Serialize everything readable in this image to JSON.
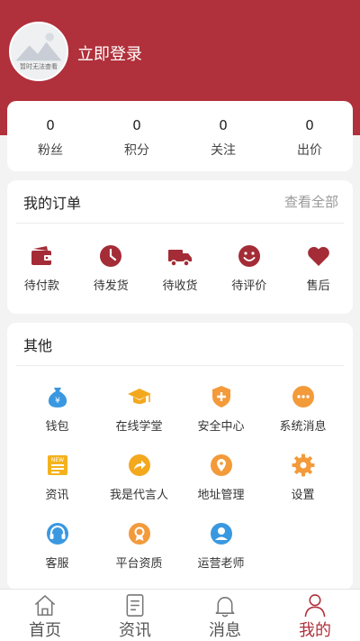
{
  "header": {
    "login_text": "立即登录",
    "avatar_caption": "暂时无法查看",
    "background_color": "#b0303b"
  },
  "stats": [
    {
      "value": "0",
      "label": "粉丝"
    },
    {
      "value": "0",
      "label": "积分"
    },
    {
      "value": "0",
      "label": "关注"
    },
    {
      "value": "0",
      "label": "出价"
    }
  ],
  "orders": {
    "title": "我的订单",
    "more": "查看全部",
    "items": [
      {
        "label": "待付款",
        "icon": "wallet-icon"
      },
      {
        "label": "待发货",
        "icon": "clock-icon"
      },
      {
        "label": "待收货",
        "icon": "truck-icon"
      },
      {
        "label": "待评价",
        "icon": "smile-icon"
      },
      {
        "label": "售后",
        "icon": "heart-icon"
      }
    ]
  },
  "others": {
    "title": "其他",
    "items": [
      {
        "label": "钱包",
        "icon": "money-bag-icon",
        "color": "#3a98e0"
      },
      {
        "label": "在线学堂",
        "icon": "graduation-cap-icon",
        "color": "#f3a81d"
      },
      {
        "label": "安全中心",
        "icon": "shield-icon",
        "color": "#f39a3a"
      },
      {
        "label": "系统消息",
        "icon": "chat-bubble-icon",
        "color": "#f39a3a"
      },
      {
        "label": "资讯",
        "icon": "news-icon",
        "color": "#f3b21d"
      },
      {
        "label": "我是代言人",
        "icon": "share-arrow-icon",
        "color": "#f3a81d"
      },
      {
        "label": "地址管理",
        "icon": "location-pin-icon",
        "color": "#f39a3a"
      },
      {
        "label": "设置",
        "icon": "gear-icon",
        "color": "#f39a3a"
      },
      {
        "label": "客服",
        "icon": "headset-icon",
        "color": "#3a98e0"
      },
      {
        "label": "平台资质",
        "icon": "certificate-icon",
        "color": "#f39a3a"
      },
      {
        "label": "运营老师",
        "icon": "teacher-icon",
        "color": "#3a98e0"
      }
    ]
  },
  "tabbar": {
    "items": [
      {
        "label": "首页",
        "icon": "home-icon"
      },
      {
        "label": "资讯",
        "icon": "document-icon"
      },
      {
        "label": "消息",
        "icon": "bell-icon"
      },
      {
        "label": "我的",
        "icon": "person-icon",
        "active": true
      }
    ],
    "active_color": "#b0303b"
  }
}
